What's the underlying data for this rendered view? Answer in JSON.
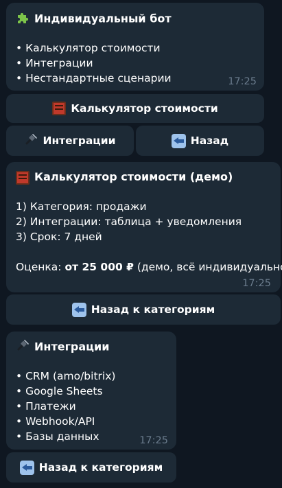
{
  "messages": [
    {
      "title": "Индивидуальный бот",
      "title_icon": "puzzle-icon",
      "lines": [
        "• Калькулятор стоимости",
        "• Интеграции",
        "• Нестандартные сценарии"
      ],
      "time": "17:25"
    },
    {
      "title": "Калькулятор стоимости (демо)",
      "title_icon": "abacus-icon",
      "lines": [
        "1) Категория: продажи",
        "2) Интеграции: таблица + уведомления",
        "3) Срок: 7 дней"
      ],
      "estimate_prefix": "Оценка: ",
      "estimate_value": "от 25 000 ₽",
      "estimate_suffix": " (демо, всё индивидуально)",
      "time": "17:25"
    },
    {
      "title": "Интеграции",
      "title_icon": "plug-icon",
      "lines": [
        "• CRM (amo/bitrix)",
        "• Google Sheets",
        "• Платежи",
        "• Webhook/API",
        "• Базы данных"
      ],
      "time": "17:25"
    }
  ],
  "buttons": {
    "calculator": "Калькулятор стоимости",
    "integrations": "Интеграции",
    "back": "Назад",
    "back_to_categories_1": "Назад к категориям",
    "back_to_categories_2": "Назад к категориям"
  },
  "colors": {
    "background": "#0f1721",
    "bubble": "#1d2a36",
    "timestamp": "#6b7c8d",
    "text": "#ffffff"
  }
}
